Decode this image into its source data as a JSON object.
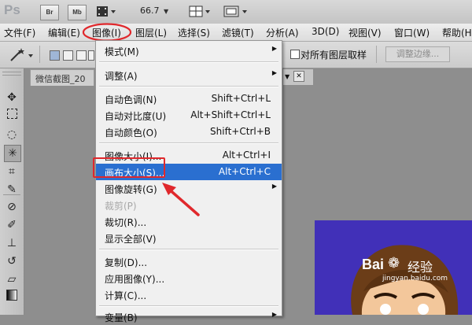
{
  "app": {
    "logo": "Ps",
    "bridge_button": "Br",
    "minibridge_button": "Mb",
    "zoom_level": "66.7"
  },
  "menubar": {
    "items": [
      {
        "label": "文件(F)"
      },
      {
        "label": "编辑(E)"
      },
      {
        "label": "图像(I)"
      },
      {
        "label": "图层(L)"
      },
      {
        "label": "选择(S)"
      },
      {
        "label": "滤镜(T)"
      },
      {
        "label": "分析(A)"
      },
      {
        "label": "3D(D)"
      },
      {
        "label": "视图(V)"
      },
      {
        "label": "窗口(W)"
      },
      {
        "label": "帮助(H)"
      }
    ]
  },
  "options": {
    "sample_all_layers": "对所有图层取样",
    "refine_edge": "调整边缘..."
  },
  "document": {
    "tab_title": "微信截图_20",
    "close_glyph": "✕"
  },
  "image_menu": {
    "items": [
      {
        "label": "模式(M)",
        "shortcut": "",
        "submenu": true
      },
      {
        "label": "调整(A)",
        "shortcut": "",
        "submenu": true
      },
      {
        "label": "自动色调(N)",
        "shortcut": "Shift+Ctrl+L"
      },
      {
        "label": "自动对比度(U)",
        "shortcut": "Alt+Shift+Ctrl+L"
      },
      {
        "label": "自动颜色(O)",
        "shortcut": "Shift+Ctrl+B"
      },
      {
        "label": "图像大小(I)...",
        "shortcut": "Alt+Ctrl+I"
      },
      {
        "label": "画布大小(S)...",
        "shortcut": "Alt+Ctrl+C",
        "highlighted": true
      },
      {
        "label": "图像旋转(G)",
        "shortcut": "",
        "submenu": true
      },
      {
        "label": "裁剪(P)",
        "shortcut": "",
        "disabled": true
      },
      {
        "label": "裁切(R)...",
        "shortcut": ""
      },
      {
        "label": "显示全部(V)",
        "shortcut": ""
      },
      {
        "label": "复制(D)...",
        "shortcut": ""
      },
      {
        "label": "应用图像(Y)...",
        "shortcut": ""
      },
      {
        "label": "计算(C)...",
        "shortcut": ""
      },
      {
        "label": "变量(B)",
        "shortcut": "",
        "submenu": true
      }
    ]
  },
  "watermark": {
    "brand": "Bai",
    "brand_suffix": "经验",
    "url": "jingyan.baidu.com"
  },
  "colors": {
    "highlight": "#2a6fd0",
    "annotation_red": "#e0282c",
    "canvas_blue": "#4130b8"
  }
}
